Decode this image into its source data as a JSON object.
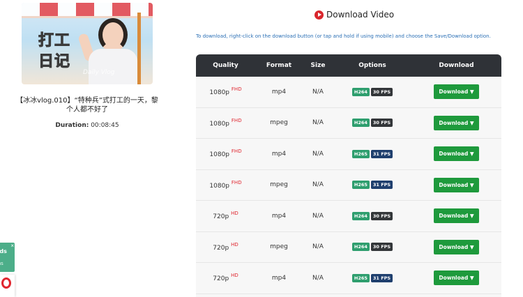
{
  "video": {
    "thumbnail_caption_line1": "打工",
    "thumbnail_caption_line2": "日记",
    "thumbnail_watermark": "Daily Vlog",
    "title": "【冰冰vlog.010】“特种兵”式打工的一天，黎个人都不好了",
    "duration_label": "Duration:",
    "duration_value": "00:08:45"
  },
  "header": {
    "title": "Download Video",
    "icon": "play-circle-icon",
    "instructions": "To download, right-click on the download button (or tap and hold if using mobile) and choose the Save/Download option."
  },
  "table": {
    "columns": [
      "Quality",
      "Format",
      "Size",
      "Options",
      "Download"
    ],
    "rows": [
      {
        "quality": "1080p",
        "badge": "FHD",
        "format": "mp4",
        "size": "N/A",
        "codec": "H264",
        "fps": "30 FPS",
        "download": "Download ▼"
      },
      {
        "quality": "1080p",
        "badge": "FHD",
        "format": "mpeg",
        "size": "N/A",
        "codec": "H264",
        "fps": "30 FPS",
        "download": "Download ▼"
      },
      {
        "quality": "1080p",
        "badge": "FHD",
        "format": "mp4",
        "size": "N/A",
        "codec": "H265",
        "fps": "31 FPS",
        "download": "Download ▼"
      },
      {
        "quality": "1080p",
        "badge": "FHD",
        "format": "mpeg",
        "size": "N/A",
        "codec": "H265",
        "fps": "31 FPS",
        "download": "Download ▼"
      },
      {
        "quality": "720p",
        "badge": "HD",
        "format": "mp4",
        "size": "N/A",
        "codec": "H264",
        "fps": "30 FPS",
        "download": "Download ▼"
      },
      {
        "quality": "720p",
        "badge": "HD",
        "format": "mpeg",
        "size": "N/A",
        "codec": "H264",
        "fps": "30 FPS",
        "download": "Download ▼"
      },
      {
        "quality": "720p",
        "badge": "HD",
        "format": "mp4",
        "size": "N/A",
        "codec": "H265",
        "fps": "31 FPS",
        "download": "Download ▼"
      }
    ]
  },
  "widget": {
    "line1": "ads",
    "line2": "dons",
    "close": "×"
  },
  "colors": {
    "accent_red": "#d9262d",
    "download_green": "#1e9a3c",
    "codec_green": "#2e9e6e",
    "fps30_dark": "#333639",
    "fps31_blue": "#1f3f6e",
    "header_dark": "#2f3237",
    "link_blue": "#2a6fb5"
  }
}
